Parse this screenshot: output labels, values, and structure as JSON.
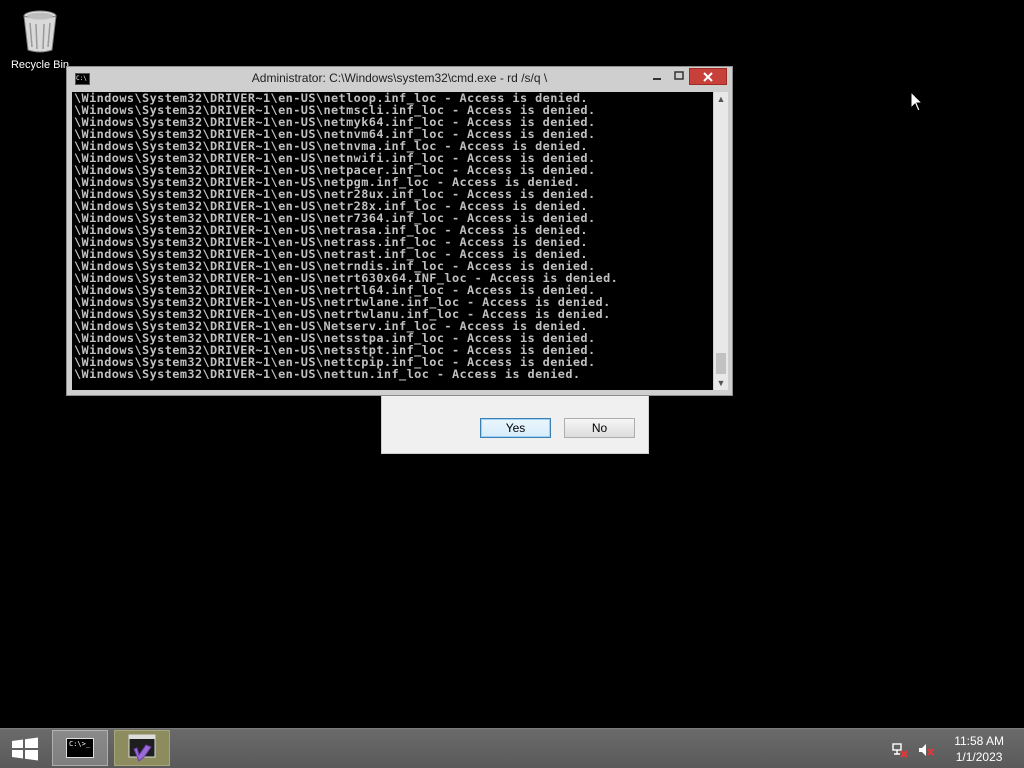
{
  "desktop": {
    "recycle_bin_label": "Recycle Bin"
  },
  "cmd_window": {
    "title": "Administrator: C:\\Windows\\system32\\cmd.exe - rd /s/q \\",
    "icon_text": "C:\\",
    "lines": [
      "\\Windows\\System32\\DRIVER~1\\en-US\\netloop.inf_loc - Access is denied.",
      "\\Windows\\System32\\DRIVER~1\\en-US\\netmscli.inf_loc - Access is denied.",
      "\\Windows\\System32\\DRIVER~1\\en-US\\netmyk64.inf_loc - Access is denied.",
      "\\Windows\\System32\\DRIVER~1\\en-US\\netnvm64.inf_loc - Access is denied.",
      "\\Windows\\System32\\DRIVER~1\\en-US\\netnvma.inf_loc - Access is denied.",
      "\\Windows\\System32\\DRIVER~1\\en-US\\netnwifi.inf_loc - Access is denied.",
      "\\Windows\\System32\\DRIVER~1\\en-US\\netpacer.inf_loc - Access is denied.",
      "\\Windows\\System32\\DRIVER~1\\en-US\\netpgm.inf_loc - Access is denied.",
      "\\Windows\\System32\\DRIVER~1\\en-US\\netr28ux.inf_loc - Access is denied.",
      "\\Windows\\System32\\DRIVER~1\\en-US\\netr28x.inf_loc - Access is denied.",
      "\\Windows\\System32\\DRIVER~1\\en-US\\netr7364.inf_loc - Access is denied.",
      "\\Windows\\System32\\DRIVER~1\\en-US\\netrasa.inf_loc - Access is denied.",
      "\\Windows\\System32\\DRIVER~1\\en-US\\netrass.inf_loc - Access is denied.",
      "\\Windows\\System32\\DRIVER~1\\en-US\\netrast.inf_loc - Access is denied.",
      "\\Windows\\System32\\DRIVER~1\\en-US\\netrndis.inf_loc - Access is denied.",
      "\\Windows\\System32\\DRIVER~1\\en-US\\netrt630x64.INF_loc - Access is denied.",
      "\\Windows\\System32\\DRIVER~1\\en-US\\netrtl64.inf_loc - Access is denied.",
      "\\Windows\\System32\\DRIVER~1\\en-US\\netrtwlane.inf_loc - Access is denied.",
      "\\Windows\\System32\\DRIVER~1\\en-US\\netrtwlanu.inf_loc - Access is denied.",
      "\\Windows\\System32\\DRIVER~1\\en-US\\Netserv.inf_loc - Access is denied.",
      "\\Windows\\System32\\DRIVER~1\\en-US\\netsstpa.inf_loc - Access is denied.",
      "\\Windows\\System32\\DRIVER~1\\en-US\\netsstpt.inf_loc - Access is denied.",
      "\\Windows\\System32\\DRIVER~1\\en-US\\nettcpip.inf_loc - Access is denied.",
      "\\Windows\\System32\\DRIVER~1\\en-US\\nettun.inf_loc - Access is denied."
    ]
  },
  "dialog": {
    "yes_label": "Yes",
    "no_label": "No"
  },
  "taskbar": {
    "cmd_icon_text": "C:\\>_",
    "time": "11:58 AM",
    "date": "1/1/2023"
  },
  "colors": {
    "desktop_bg": "#000000",
    "close_button": "#c7403a",
    "console_text": "#c0c0c0"
  }
}
